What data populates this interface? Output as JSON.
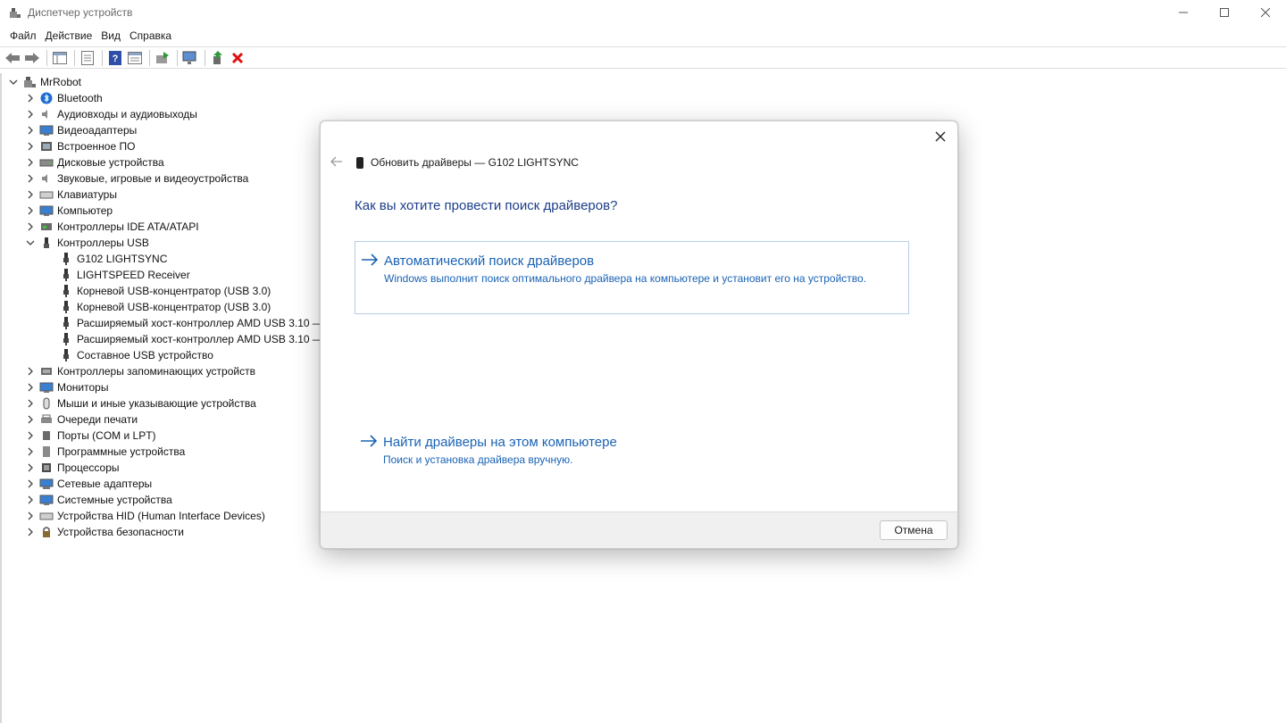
{
  "window": {
    "title": "Диспетчер устройств",
    "controls": [
      "minimize-icon",
      "maximize-icon",
      "close-icon"
    ]
  },
  "menu": {
    "file": "Файл",
    "action": "Действие",
    "view": "Вид",
    "help": "Справка"
  },
  "toolbar": {
    "icons": [
      "back-icon",
      "forward-icon",
      "show-hide-tree-icon",
      "properties-icon",
      "help-icon",
      "view-details-icon",
      "update-driver-icon",
      "scan-hardware-icon",
      "enable-device-icon",
      "uninstall-device-icon"
    ]
  },
  "tree": {
    "root": "MrRobot",
    "items": [
      {
        "label": "Bluetooth",
        "icon": "bluetooth-icon"
      },
      {
        "label": "Аудиовходы и аудиовыходы",
        "icon": "speaker-icon"
      },
      {
        "label": "Видеоадаптеры",
        "icon": "display-adapter-icon"
      },
      {
        "label": "Встроенное ПО",
        "icon": "firmware-icon"
      },
      {
        "label": "Дисковые устройства",
        "icon": "disk-icon"
      },
      {
        "label": "Звуковые, игровые и видеоустройства",
        "icon": "sound-icon"
      },
      {
        "label": "Клавиатуры",
        "icon": "keyboard-icon"
      },
      {
        "label": "Компьютер",
        "icon": "computer-icon"
      },
      {
        "label": "Контроллеры IDE ATA/ATAPI",
        "icon": "ide-controller-icon"
      },
      {
        "label": "Контроллеры USB",
        "icon": "usb-icon",
        "expanded": true
      },
      {
        "label": "Контроллеры запоминающих устройств",
        "icon": "storage-controller-icon"
      },
      {
        "label": "Мониторы",
        "icon": "monitor-icon"
      },
      {
        "label": "Мыши и иные указывающие устройства",
        "icon": "mouse-icon"
      },
      {
        "label": "Очереди печати",
        "icon": "printer-icon"
      },
      {
        "label": "Порты (COM и LPT)",
        "icon": "port-icon"
      },
      {
        "label": "Программные устройства",
        "icon": "software-device-icon"
      },
      {
        "label": "Процессоры",
        "icon": "processor-icon"
      },
      {
        "label": "Сетевые адаптеры",
        "icon": "network-adapter-icon"
      },
      {
        "label": "Системные устройства",
        "icon": "system-device-icon"
      },
      {
        "label": "Устройства HID (Human Interface Devices)",
        "icon": "hid-icon"
      },
      {
        "label": "Устройства безопасности",
        "icon": "security-device-icon"
      }
    ],
    "usb_children": [
      "G102 LIGHTSYNC",
      "LIGHTSPEED Receiver",
      "Корневой USB-концентратор (USB 3.0)",
      "Корневой USB-концентратор (USB 3.0)",
      "Расширяемый хост-контроллер AMD USB 3.10 —",
      "Расширяемый хост-контроллер AMD USB 3.10 —",
      "Составное USB устройство"
    ]
  },
  "dialog": {
    "header": "Обновить драйверы — G102 LIGHTSYNC",
    "question": "Как вы хотите провести поиск драйверов?",
    "auto_title": "Автоматический поиск драйверов",
    "auto_desc": "Windows выполнит поиск оптимального драйвера на компьютере и установит его на устройство.",
    "manual_title": "Найти драйверы на этом компьютере",
    "manual_desc": "Поиск и установка драйвера вручную.",
    "cancel": "Отмена"
  },
  "colors": {
    "link": "#1a63b4",
    "question": "#1c3e8a",
    "option_border": "#b7cde8",
    "footer_bg": "#f0f0f0"
  }
}
